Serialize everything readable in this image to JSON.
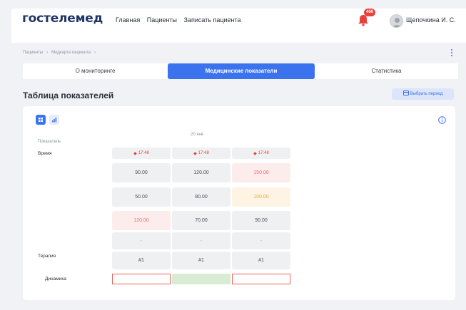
{
  "header": {
    "logo": "гостелемед",
    "nav": [
      "Главная",
      "Пациенты",
      "Записать пациента"
    ],
    "notifications_count": "466",
    "user_name": "Щепочкина И. С."
  },
  "breadcrumbs": [
    "Пациенты",
    "Медкарта пациента"
  ],
  "tabs": [
    {
      "label": "О мониторинге",
      "active": false
    },
    {
      "label": "Медицинские показатели",
      "active": true
    },
    {
      "label": "Статистика",
      "active": false
    }
  ],
  "section": {
    "title": "Таблица показателей",
    "period_button": "Выбрать период"
  },
  "table": {
    "date": "20 янв",
    "indicator_header": "Показатель",
    "row_labels": {
      "time": "Время",
      "therapy": "Терапия",
      "dynamics": "Динамика"
    },
    "times": [
      "17:48",
      "17:48",
      "17:48"
    ],
    "values": [
      [
        {
          "v": "90.00",
          "s": "normal"
        },
        {
          "v": "120.00",
          "s": "normal"
        },
        {
          "v": "150.00",
          "s": "red"
        }
      ],
      [
        {
          "v": "50.00",
          "s": "normal"
        },
        {
          "v": "80.00",
          "s": "normal"
        },
        {
          "v": "100.00",
          "s": "orange"
        }
      ],
      [
        {
          "v": "120.00",
          "s": "red"
        },
        {
          "v": "70.00",
          "s": "normal"
        },
        {
          "v": "90.00",
          "s": "normal"
        }
      ],
      [
        {
          "v": "-",
          "s": "dash"
        },
        {
          "v": "-",
          "s": "dash"
        },
        {
          "v": "-",
          "s": "dash"
        }
      ]
    ],
    "therapy": [
      "#1",
      "#1",
      "#1"
    ],
    "dynamics": [
      "red",
      "green",
      "red"
    ]
  },
  "colors": {
    "accent": "#3b72ed",
    "alert": "#e8403a",
    "brand": "#1f3566"
  }
}
